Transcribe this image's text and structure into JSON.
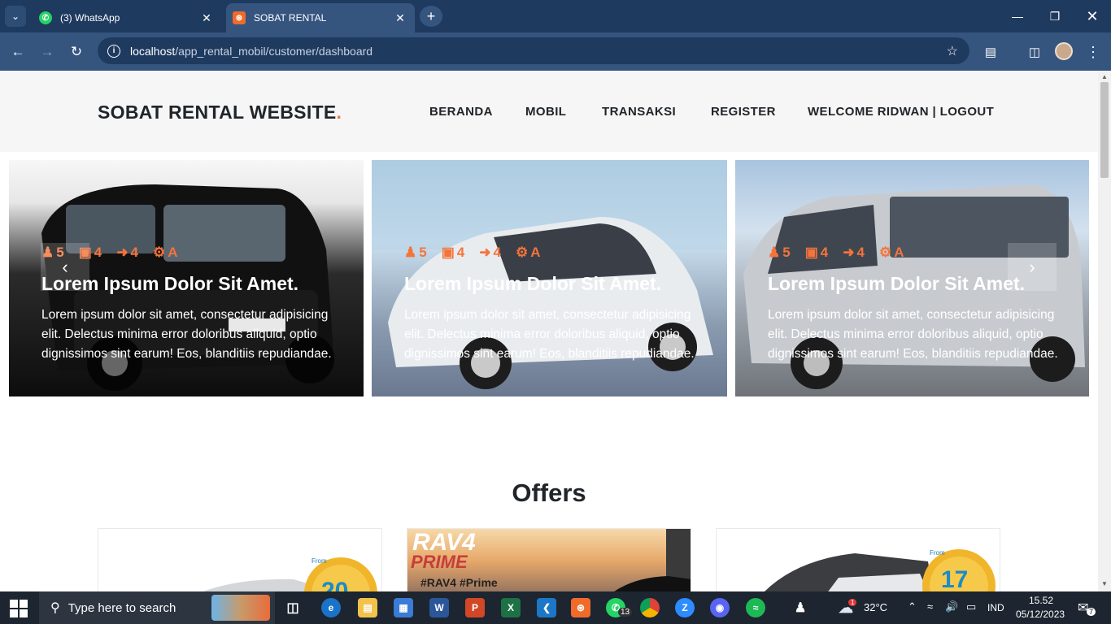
{
  "browser": {
    "tabs": [
      {
        "title": "(3) WhatsApp",
        "favicon": "whatsapp-icon",
        "active": false
      },
      {
        "title": "SOBAT RENTAL",
        "favicon": "xampp-icon",
        "active": true
      }
    ],
    "url_host": "localhost",
    "url_path": "/app_rental_mobil/customer/dashboard"
  },
  "site": {
    "logo": "SOBAT RENTAL WEBSITE",
    "logo_dot": ".",
    "nav": [
      "BERANDA",
      "MOBIL",
      "TRANSAKSI",
      "REGISTER",
      "WELCOME RIDWAN | LOGOUT"
    ]
  },
  "slides": [
    {
      "seats": "5",
      "bags": "4",
      "doors": "4",
      "transmission": "A",
      "title": "Lorem Ipsum Dolor Sit Amet.",
      "text": "Lorem ipsum dolor sit amet, consectetur adipisicing elit. Delectus minima error doloribus aliquid, optio dignissimos sint earum! Eos, blanditiis repudiandae."
    },
    {
      "seats": "5",
      "bags": "4",
      "doors": "4",
      "transmission": "A",
      "title": "Lorem Ipsum Dolor Sit Amet.",
      "text": "Lorem ipsum dolor sit amet, consectetur adipisicing elit. Delectus minima error doloribus aliquid, optio dignissimos sint earum! Eos, blanditiis repudiandae."
    },
    {
      "seats": "5",
      "bags": "4",
      "doors": "4",
      "transmission": "A",
      "title": "Lorem Ipsum Dolor Sit Amet.",
      "text": "Lorem ipsum dolor sit amet, consectetur adipisicing elit. Delectus minima error doloribus aliquid, optio dignissimos sint earum! Eos, blanditiis repudiandae."
    }
  ],
  "carousel": {
    "prev": "‹",
    "next": "›"
  },
  "offers": {
    "title": "Offers",
    "cards": [
      {
        "badge_small": "From",
        "badge_number": "20"
      },
      {
        "headline": "RAV4",
        "subline": "PRIME",
        "hashtag": "#RAV4 #Prime"
      },
      {
        "badge_small": "From",
        "badge_number": "17"
      }
    ]
  },
  "taskbar": {
    "search_placeholder": "Type here to search",
    "weather": "32°C",
    "language": "IND",
    "time": "15.52",
    "date": "05/12/2023",
    "notifications": "7",
    "whatsapp_badge": "13",
    "weather_badge": "1"
  },
  "colors": {
    "accent": "#f4743b",
    "chrome_dark": "#1f3a5f",
    "chrome_light": "#35557f"
  }
}
